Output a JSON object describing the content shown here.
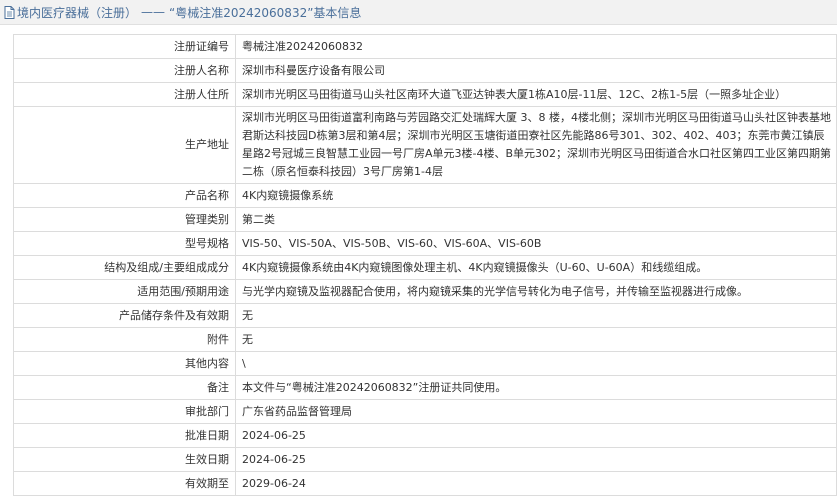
{
  "header": {
    "category": "境内医疗器械（注册）",
    "separator": "——",
    "title": "“粤械注准20242060832”基本信息"
  },
  "rows": [
    {
      "label": "注册证编号",
      "value": "粤械注准20242060832"
    },
    {
      "label": "注册人名称",
      "value": "深圳市科曼医疗设备有限公司"
    },
    {
      "label": "注册人住所",
      "value": "深圳市光明区马田街道马山头社区南环大道飞亚达钟表大厦1栋A10层-11层、12C、2栋1-5层（一照多址企业）"
    },
    {
      "label": "生产地址",
      "value": "深圳市光明区马田街道富利南路与芳园路交汇处瑞辉大厦 3、8 楼，4楼北侧；深圳市光明区马田街道马山头社区钟表基地君斯达科技园D栋第3层和第4层；深圳市光明区玉塘街道田寮社区先能路86号301、302、402、403；东莞市黄江镇辰星路2号冠城三良智慧工业园一号厂房A单元3楼-4楼、B单元302；深圳市光明区马田街道合水口社区第四工业区第四期第二栋（原名恒泰科技园）3号厂房第1-4层"
    },
    {
      "label": "产品名称",
      "value": "4K内窥镜摄像系统"
    },
    {
      "label": "管理类别",
      "value": "第二类"
    },
    {
      "label": "型号规格",
      "value": "VIS-50、VIS-50A、VIS-50B、VIS-60、VIS-60A、VIS-60B"
    },
    {
      "label": "结构及组成/主要组成成分",
      "value": "4K内窥镜摄像系统由4K内窥镜图像处理主机、4K内窥镜摄像头（U-60、U-60A）和线缆组成。"
    },
    {
      "label": "适用范围/预期用途",
      "value": "与光学内窥镜及监视器配合使用，将内窥镜采集的光学信号转化为电子信号，并传输至监视器进行成像。"
    },
    {
      "label": "产品储存条件及有效期",
      "value": "无"
    },
    {
      "label": "附件",
      "value": "无"
    },
    {
      "label": "其他内容",
      "value": "\\"
    },
    {
      "label": "备注",
      "value": "本文件与“粤械注准20242060832”注册证共同使用。"
    },
    {
      "label": "审批部门",
      "value": "广东省药品监督管理局"
    },
    {
      "label": "批准日期",
      "value": "2024-06-25"
    },
    {
      "label": "生效日期",
      "value": "2024-06-25"
    },
    {
      "label": "有效期至",
      "value": "2029-06-24"
    }
  ]
}
